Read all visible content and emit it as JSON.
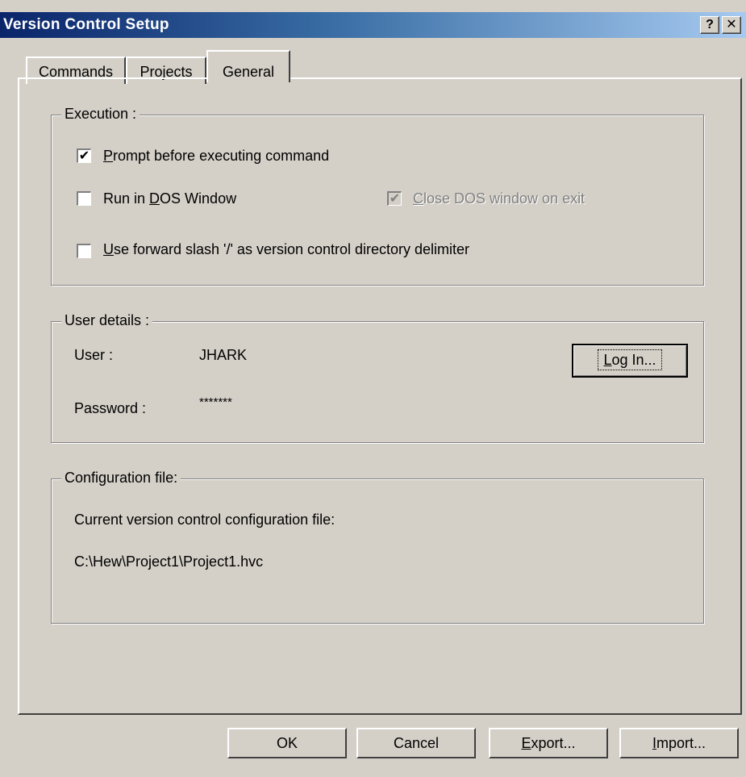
{
  "window": {
    "title": "Version Control Setup",
    "help": "?",
    "close": "✕"
  },
  "tabs": [
    {
      "label": "Commands"
    },
    {
      "label": "Projects"
    },
    {
      "label": "General",
      "active": true
    }
  ],
  "execution": {
    "legend": "Execution :",
    "prompt": {
      "label_u": "P",
      "label_rest": "rompt before executing command",
      "checked": true
    },
    "run_dos": {
      "label_pre": "Run in ",
      "label_u": "D",
      "label_rest": "OS Window",
      "checked": false
    },
    "close_dos": {
      "label_u": "C",
      "label_rest": "lose DOS window on exit",
      "checked": true,
      "disabled": true
    },
    "forward_slash": {
      "label_u": "U",
      "label_rest": "se forward slash '/' as version control directory delimiter",
      "checked": false
    }
  },
  "user_details": {
    "legend": "User details :",
    "user_label": "User :",
    "user_value": "JHARK",
    "password_label": "Password :",
    "password_value": "*******",
    "login_u": "L",
    "login_rest": "og In..."
  },
  "config": {
    "legend": "Configuration file:",
    "label": "Current version control configuration file:",
    "path": "C:\\Hew\\Project1\\Project1.hvc"
  },
  "buttons": {
    "ok": "OK",
    "cancel": "Cancel",
    "export_u": "E",
    "export_rest": "xport...",
    "import_u": "I",
    "import_rest": "mport..."
  }
}
